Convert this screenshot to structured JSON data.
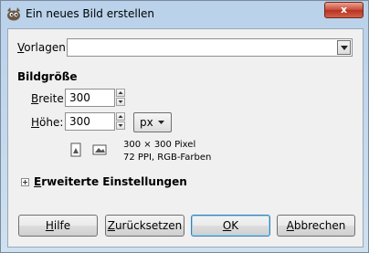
{
  "window": {
    "title": "Ein neues Bild erstellen",
    "close_label": "x"
  },
  "template": {
    "label_prefix": "",
    "label_mnemonic": "V",
    "label_rest": "orlagen:",
    "value": ""
  },
  "image_size": {
    "heading": "Bildgröße",
    "width_mnemonic": "B",
    "width_rest": "reite:",
    "width_value": "300",
    "height_mnemonic": "H",
    "height_rest": "öhe:",
    "height_value": "300",
    "unit": "px",
    "info_dimensions": "300 × 300 Pixel",
    "info_format": "72 PPI, RGB-Farben"
  },
  "advanced": {
    "mnemonic": "E",
    "rest": "rweiterte Einstellungen"
  },
  "buttons": {
    "help_mnemonic": "H",
    "help_rest": "ilfe",
    "reset_mnemonic": "Z",
    "reset_rest": "urücksetzen",
    "ok_mnemonic": "O",
    "ok_rest": "K",
    "cancel_mnemonic": "A",
    "cancel_rest": "bbrechen"
  },
  "colors": {
    "titlebar": "#b9d1ea",
    "client": "#f0f0f0",
    "default_button_border": "#3c7fb1"
  },
  "icons": {
    "app": "gimp-icon",
    "portrait": "portrait-orientation-icon",
    "landscape": "landscape-orientation-icon"
  }
}
